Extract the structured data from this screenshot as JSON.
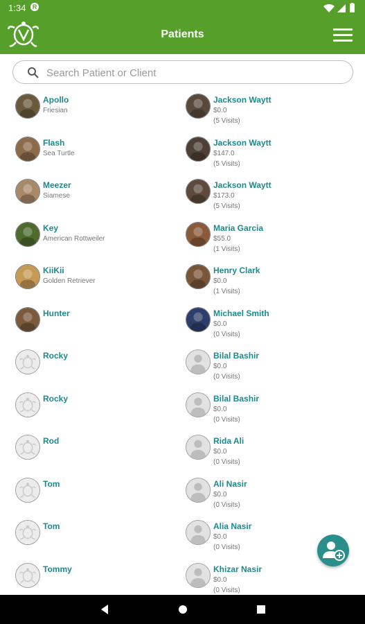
{
  "status_bar": {
    "time": "1:34",
    "rec_badge": "R"
  },
  "app_bar": {
    "title": "Patients",
    "logo_icon": "turtle-logo-icon",
    "menu_icon": "hamburger-menu-icon"
  },
  "search": {
    "placeholder": "Search Patient or Client",
    "value": ""
  },
  "patients": [
    {
      "name": "Apollo",
      "breed": "Friesian",
      "avatar": "photo"
    },
    {
      "name": "Flash",
      "breed": "Sea Turtle",
      "avatar": "photo"
    },
    {
      "name": "Meezer",
      "breed": "Siamese",
      "avatar": "photo"
    },
    {
      "name": "Key",
      "breed": "American Rottweiler",
      "avatar": "photo"
    },
    {
      "name": "KiiKii",
      "breed": "Golden Retriever",
      "avatar": "photo"
    },
    {
      "name": "Hunter",
      "breed": "",
      "avatar": "photo"
    },
    {
      "name": "Rocky",
      "breed": "",
      "avatar": "turtle-placeholder"
    },
    {
      "name": "Rocky",
      "breed": "",
      "avatar": "turtle-placeholder"
    },
    {
      "name": "Rod",
      "breed": "",
      "avatar": "turtle-placeholder"
    },
    {
      "name": "Tom",
      "breed": "",
      "avatar": "turtle-placeholder"
    },
    {
      "name": "Tom",
      "breed": "",
      "avatar": "turtle-placeholder"
    },
    {
      "name": "Tommy",
      "breed": "",
      "avatar": "turtle-placeholder"
    }
  ],
  "clients": [
    {
      "name": "Jackson Waytt",
      "amount": "$0.0",
      "visits": "(5 Visits)",
      "avatar": "photo"
    },
    {
      "name": "Jackson Waytt",
      "amount": "$147.0",
      "visits": "(5 Visits)",
      "avatar": "photo"
    },
    {
      "name": "Jackson Waytt",
      "amount": "$173.0",
      "visits": "(5 Visits)",
      "avatar": "photo"
    },
    {
      "name": "Maria Garcia",
      "amount": "$55.0",
      "visits": "(1 Visits)",
      "avatar": "photo"
    },
    {
      "name": "Henry Clark",
      "amount": "$0.0",
      "visits": "(1 Visits)",
      "avatar": "photo"
    },
    {
      "name": "Michael Smith",
      "amount": "$0.0",
      "visits": "(0 Visits)",
      "avatar": "photo"
    },
    {
      "name": "Bilal Bashir",
      "amount": "$0.0",
      "visits": "(0 Visits)",
      "avatar": "person-placeholder"
    },
    {
      "name": "Bilal Bashir",
      "amount": "$0.0",
      "visits": "(0 Visits)",
      "avatar": "person-placeholder"
    },
    {
      "name": "Rida Ali",
      "amount": "$0.0",
      "visits": "(0 Visits)",
      "avatar": "person-placeholder"
    },
    {
      "name": "Ali Nasir",
      "amount": "$0.0",
      "visits": "(0 Visits)",
      "avatar": "person-placeholder"
    },
    {
      "name": "Alia Nasir",
      "amount": "$0.0",
      "visits": "(0 Visits)",
      "avatar": "person-placeholder"
    },
    {
      "name": "Khizar  Nasir",
      "amount": "$0.0",
      "visits": "(0 Visits)",
      "avatar": "person-placeholder"
    }
  ],
  "fab": {
    "icon": "add-person-icon"
  },
  "nav_bar": {
    "back_icon": "back-triangle-icon",
    "home_icon": "home-circle-icon",
    "recents_icon": "recents-square-icon"
  },
  "colors": {
    "primary_green": "#579f2b",
    "name_teal": "#1a8a8d",
    "fab_teal": "#2a8f8b"
  }
}
